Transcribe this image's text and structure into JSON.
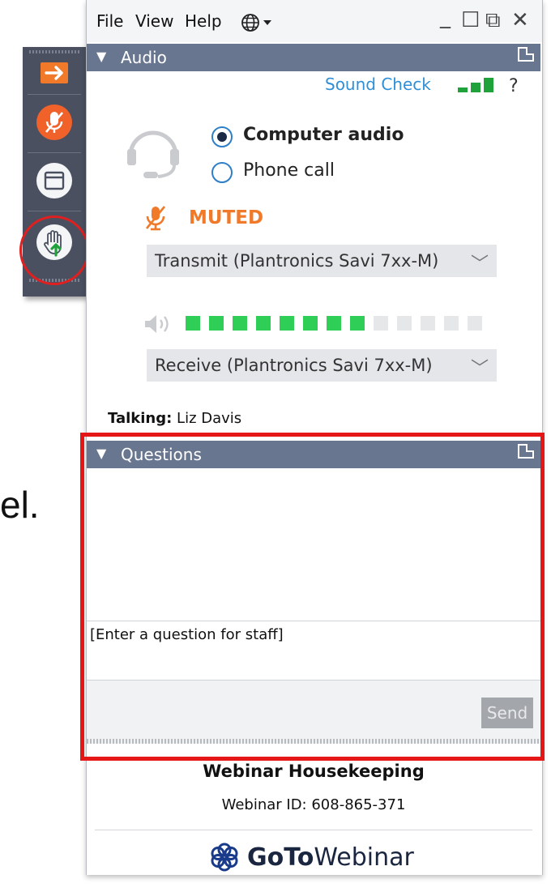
{
  "background": {
    "text_fragment": "el."
  },
  "menu": {
    "file": "File",
    "view": "View",
    "help": "Help"
  },
  "window_controls": {
    "minimize": "_",
    "maximize": "☐",
    "restore": "⧉",
    "close": "✕"
  },
  "audio": {
    "header": "Audio",
    "sound_check": "Sound Check",
    "help": "?",
    "computer_audio": "Computer audio",
    "phone_call": "Phone call",
    "selected_mode": "Computer audio",
    "mute_status": "MUTED",
    "transmit_device": "Transmit (Plantronics Savi 7xx-M)",
    "receive_device": "Receive (Plantronics Savi 7xx-M)",
    "speaker_level_filled": 8,
    "speaker_level_total": 13,
    "signal_bars_total": 3
  },
  "talking": {
    "label": "Talking:",
    "name": "Liz Davis"
  },
  "questions": {
    "header": "Questions",
    "input_placeholder": "[Enter a question for staff]",
    "send_label": "Send"
  },
  "footer": {
    "title": "Webinar Housekeeping",
    "webinar_id": "Webinar ID: 608-865-371",
    "brand_bold": "GoTo",
    "brand_light": "Webinar"
  },
  "colors": {
    "header_bg": "#697690",
    "rail_bg": "#4a5060",
    "accent_orange": "#f07a2a",
    "level_green": "#2fce56",
    "level_empty": "#e6e7e9",
    "highlight_red": "#e51616",
    "link_blue": "#2f8fd8"
  },
  "icons": {
    "rail": [
      "arrow-right-icon",
      "mic-muted-icon",
      "window-icon",
      "raise-hand-icon"
    ],
    "audio": [
      "headset-icon",
      "mic-muted-icon",
      "speaker-icon",
      "signal-bars-icon"
    ],
    "menu": [
      "globe-icon"
    ],
    "brand": [
      "gotowebinar-logo-icon"
    ]
  }
}
